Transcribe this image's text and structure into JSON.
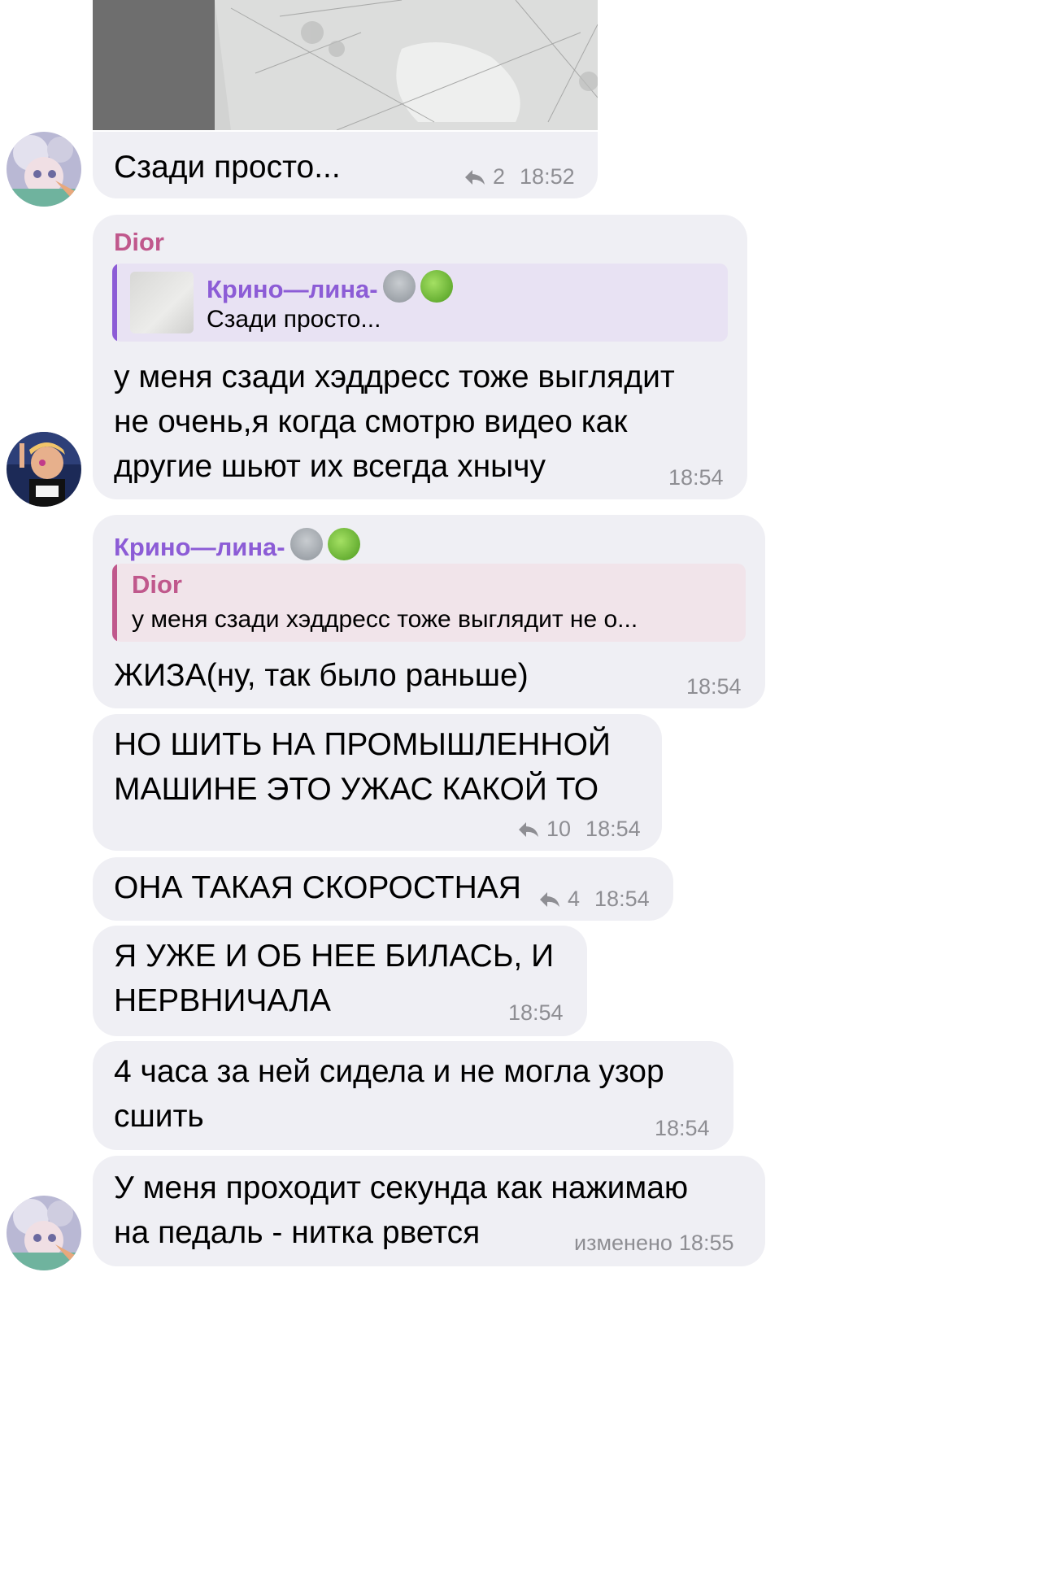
{
  "messages": {
    "m1": {
      "text": "Сзади просто...",
      "replies": "2",
      "time": "18:52"
    },
    "m2": {
      "sender": "Dior",
      "quote": {
        "sender": "Крино—лина-",
        "text": "Сзади просто..."
      },
      "lines": [
        "у меня сзади хэддресс тоже выглядит",
        "не очень,я когда смотрю видео как",
        "другие шьют их всегда хнычу"
      ],
      "time": "18:54"
    },
    "m3": {
      "sender": "Крино—лина-",
      "quote": {
        "sender": "Dior",
        "text": "у меня сзади хэддресс тоже выглядит не о..."
      },
      "text": "ЖИЗА(ну, так было раньше)",
      "time": "18:54"
    },
    "m4": {
      "lines": [
        "НО ШИТЬ НА ПРОМЫШЛЕННОЙ",
        "МАШИНЕ ЭТО УЖАС КАКОЙ ТО"
      ],
      "replies": "10",
      "time": "18:54"
    },
    "m5": {
      "text": "ОНА ТАКАЯ СКОРОСТНАЯ",
      "replies": "4",
      "time": "18:54"
    },
    "m6": {
      "lines": [
        "Я УЖЕ И ОБ НЕЕ БИЛАСЬ, И",
        "НЕРВНИЧАЛА"
      ],
      "time": "18:54"
    },
    "m7": {
      "lines": [
        "4 часа за ней сидела и не могла узор",
        "сшить"
      ],
      "time": "18:54"
    },
    "m8": {
      "lines": [
        "У меня проходит секунда как нажимаю",
        "на педаль - нитка рвется"
      ],
      "edited": "изменено",
      "time": "18:55"
    }
  },
  "colors": {
    "bubble": "#efeff4",
    "meta": "#8e8e93",
    "dior": "#c0588c",
    "krinolina": "#8c5cd6",
    "quote_krinolina_bg": "#e8e2f3",
    "quote_dior_bg": "#f1e4ea"
  },
  "icons": [
    "reply-arrow-icon",
    "alien-emoji-icon",
    "green-apple-emoji-icon",
    "avatar-anime-girl",
    "avatar-dior"
  ]
}
